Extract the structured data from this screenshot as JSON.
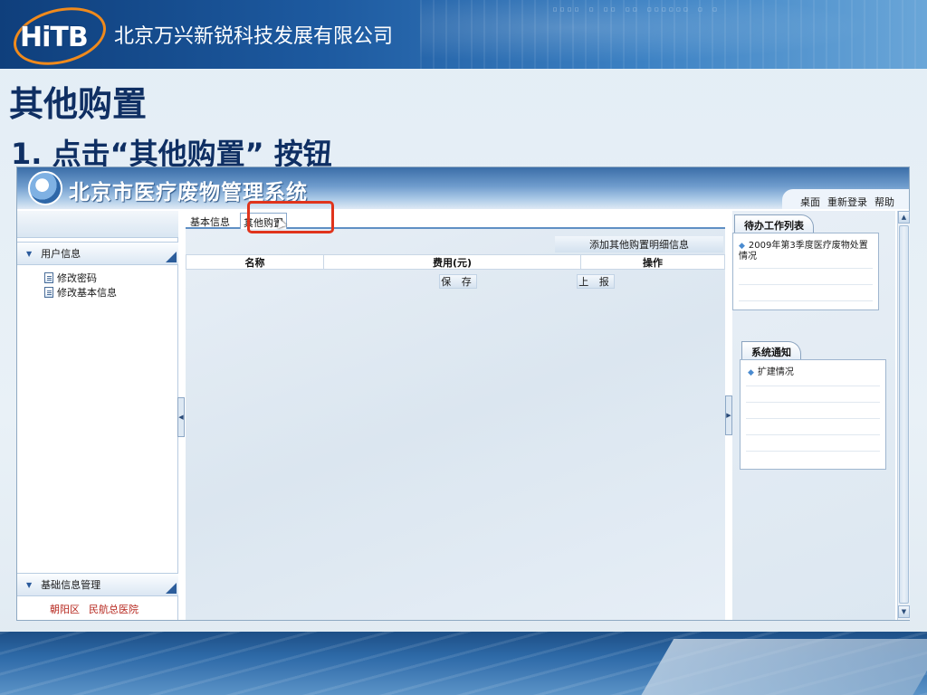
{
  "slide": {
    "company_logo_text": "HiTB",
    "company_name": "北京万兴新锐科技发展有限公司",
    "header_digits": "▫▫▫▫ ▫ ▫▫  ▫▫ ▫▫▫▫▫▫ ▫  ▫",
    "title": "其他购置",
    "step": "1. 点击“其他购置” 按钮"
  },
  "app": {
    "title": "北京市医疗废物管理系统",
    "top_links": [
      "桌面",
      "重新登录",
      "帮助"
    ]
  },
  "sidebar": {
    "sections": [
      {
        "label": "用户信息",
        "items": [
          "修改密码",
          "修改基本信息"
        ]
      },
      {
        "label": "基础信息管理",
        "items": []
      }
    ],
    "location": [
      "朝阳区",
      "民航总医院"
    ]
  },
  "tabs": [
    {
      "label": "基本信息",
      "active": false
    },
    {
      "label": "其他购置",
      "active": true
    }
  ],
  "main": {
    "add_button": "添加其他购置明细信息",
    "columns": [
      "名称",
      "费用(元)",
      "操作"
    ],
    "save_button": "保 存",
    "report_button": "上 报"
  },
  "right": {
    "todo": {
      "title": "待办工作列表",
      "items": [
        "2009年第3季度医疗废物处置情况"
      ]
    },
    "notice": {
      "title": "系统通知",
      "items": [
        "扩建情况"
      ]
    }
  },
  "colors": {
    "highlight": "#e0341c",
    "title_text": "#0f2f63",
    "location_text": "#b7281f"
  }
}
